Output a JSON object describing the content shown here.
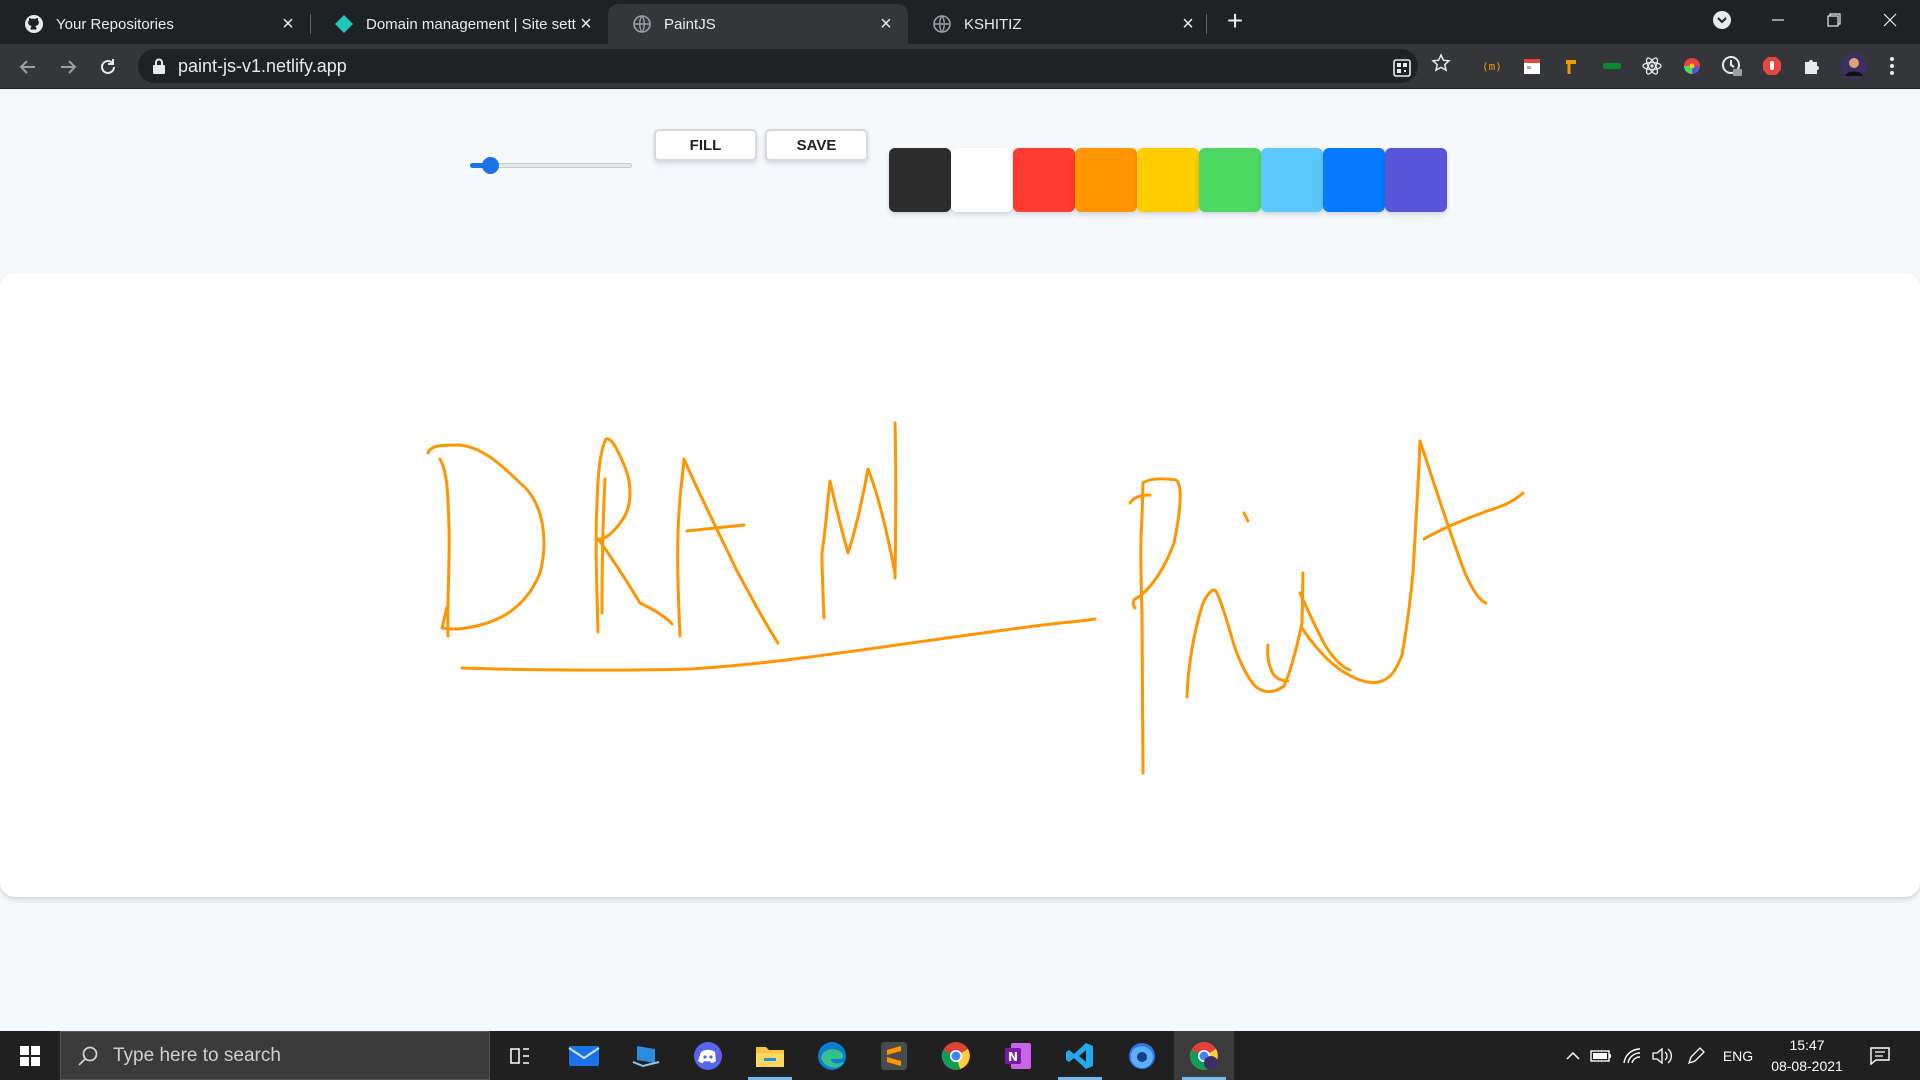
{
  "browser": {
    "tabs": [
      {
        "title": "Your Repositories",
        "icon": "github-icon",
        "active": false
      },
      {
        "title": "Domain management | Site settings",
        "icon": "netlify-icon",
        "active": false
      },
      {
        "title": "PaintJS",
        "icon": "globe-icon",
        "active": true
      },
      {
        "title": "KSHITIZ",
        "icon": "globe-icon",
        "active": false
      }
    ],
    "url": "paint-js-v1.netlify.app"
  },
  "app": {
    "range": {
      "min": 0.1,
      "max": 5.0,
      "value": 0.5
    },
    "fill_label": "Fill",
    "save_label": "Save",
    "colors": [
      "#2c2c2c",
      "#ffffff",
      "#ff3b30",
      "#ff9500",
      "#ffcc00",
      "#4cd963",
      "#5ac8fa",
      "#0579ff",
      "#5856d6"
    ],
    "stroke_color": "#ff9500"
  },
  "taskbar": {
    "search_placeholder": "Type here to search",
    "apps": [
      "task-view-icon",
      "mail-icon",
      "file-transfer-icon",
      "discord-icon",
      "file-explorer-icon",
      "edge-icon",
      "sublime-text-icon",
      "chrome-icon",
      "onenote-icon",
      "vscode-icon",
      "firefox-icon",
      "chrome-profile-icon"
    ],
    "language": "ENG",
    "time": "15:47",
    "date": "08-08-2021"
  }
}
